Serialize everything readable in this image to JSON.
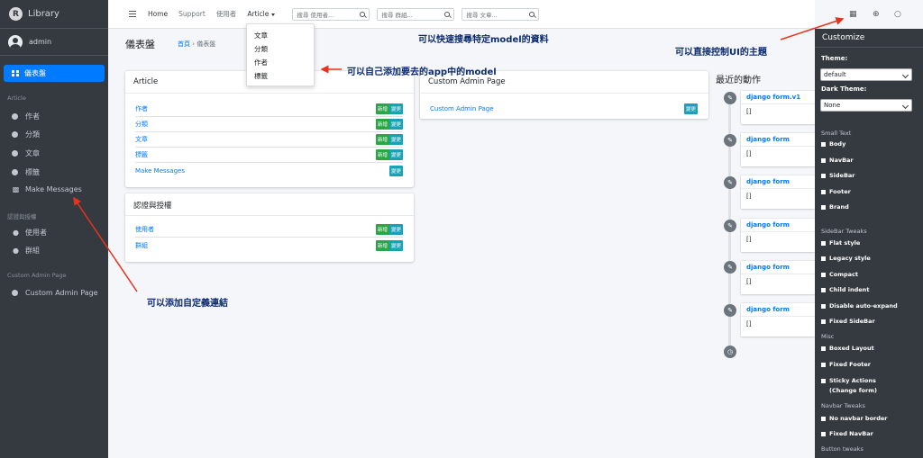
{
  "sidebar": {
    "brand": "Library",
    "user": "admin",
    "active_item": "儀表盤",
    "headers": [
      "Article",
      "認證與授權",
      "Custom Admin Page"
    ],
    "article_items": [
      "作者",
      "分類",
      "文章",
      "標籤",
      "Make Messages"
    ],
    "auth_items": [
      "使用者",
      "群組"
    ],
    "custom_items": [
      "Custom Admin Page"
    ]
  },
  "navbar": {
    "links": [
      "Home",
      "Support",
      "使用者"
    ],
    "article_menu": "Article",
    "search_user": "搜尋 使用者...",
    "search_group": "搜尋 群組...",
    "search_article": "搜尋 文章..."
  },
  "dropdown": {
    "items": [
      "文章",
      "分類",
      "作者",
      "標籤"
    ]
  },
  "content": {
    "title": "儀表盤",
    "breadcrumb_home": "首頁",
    "breadcrumb_sep": "›",
    "breadcrumb_current": "儀表盤",
    "add_label": "新增",
    "change_label": "變更"
  },
  "cards": {
    "article": {
      "title": "Article",
      "rows": [
        "作者",
        "分類",
        "文章",
        "標籤",
        "Make Messages"
      ]
    },
    "auth": {
      "title": "認證與授權",
      "rows": [
        "使用者",
        "群組"
      ]
    },
    "custom": {
      "title": "Custom Admin Page",
      "rows": [
        "Custom Admin Page"
      ]
    }
  },
  "timeline": {
    "title": "最近的動作",
    "entries": [
      {
        "head": "django form.v1",
        "body": "[]"
      },
      {
        "head": "django form",
        "body": "[]"
      },
      {
        "head": "django form",
        "body": "[]"
      },
      {
        "head": "django form",
        "body": "[]"
      },
      {
        "head": "django form",
        "body": "[]"
      },
      {
        "head": "django form",
        "body": "[]"
      }
    ]
  },
  "customize": {
    "title": "Customize",
    "theme_label": "Theme:",
    "theme_value": "default",
    "dark_theme_label": "Dark Theme:",
    "dark_theme_value": "None",
    "small_text": {
      "header": "Small Text",
      "options": [
        "Body",
        "NavBar",
        "SideBar",
        "Footer",
        "Brand"
      ]
    },
    "sidebar_tweaks": {
      "header": "SideBar Tweaks",
      "options": [
        "Flat style",
        "Legacy style",
        "Compact",
        "Child indent",
        "Disable auto-expand",
        "Fixed SideBar"
      ]
    },
    "misc": {
      "header": "Misc",
      "options": [
        "Boxed Layout",
        "Fixed Footer",
        "Sticky Actions"
      ],
      "sticky_sub": "(Change form)"
    },
    "navbar_tweaks": {
      "header": "Navbar Tweaks",
      "options": [
        "No navbar border",
        "Fixed NavBar"
      ]
    },
    "button_tweaks": {
      "header": "Button tweaks"
    }
  },
  "annotations": {
    "search": "可以快速搜尋特定model的資料",
    "theme": "可以直接控制UI的主題",
    "model": "可以自己添加要去的app中的model",
    "link": "可以添加自定義連結"
  },
  "colors": {
    "sidebar_bg": "#343a40",
    "primary": "#007bff",
    "add_green": "#28a745",
    "change_cyan": "#17a2b8",
    "arrow_red": "#e8321e"
  },
  "icons": {
    "user": "user-icon",
    "users": "users-icon",
    "comments": "comments-icon",
    "dashboard": "dashboard-grid-icon"
  }
}
